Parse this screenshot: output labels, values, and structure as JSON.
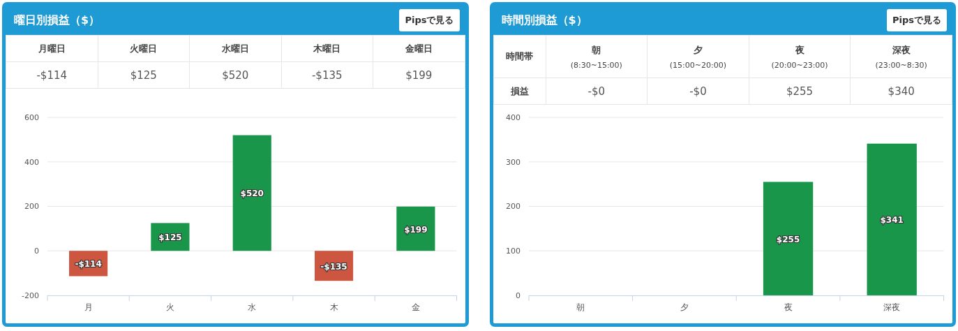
{
  "panels": [
    {
      "title": "曜日別損益（$）",
      "button": "Pipsで見る",
      "table": {
        "headers": [
          {
            "label": "月曜日"
          },
          {
            "label": "火曜日"
          },
          {
            "label": "水曜日"
          },
          {
            "label": "木曜日"
          },
          {
            "label": "金曜日"
          }
        ],
        "values": [
          "-$114",
          "$125",
          "$520",
          "-$135",
          "$199"
        ]
      },
      "chart_data": {
        "type": "bar",
        "categories": [
          "月",
          "火",
          "水",
          "木",
          "金"
        ],
        "values": [
          -114,
          125,
          520,
          -135,
          199
        ],
        "ylim": [
          -200,
          600
        ],
        "yticks": [
          -200,
          0,
          200,
          400,
          600
        ],
        "grid": true,
        "value_labels": [
          "-$114",
          "$125",
          "$520",
          "-$135",
          "$199"
        ]
      }
    },
    {
      "title": "時間別損益（$）",
      "button": "Pipsで見る",
      "table": {
        "row_labels": [
          "時間帯",
          "損益"
        ],
        "headers": [
          {
            "label": "朝",
            "sub": "(8:30~15:00)"
          },
          {
            "label": "夕",
            "sub": "(15:00~20:00)"
          },
          {
            "label": "夜",
            "sub": "(20:00~23:00)"
          },
          {
            "label": "深夜",
            "sub": "(23:00~8:30)"
          }
        ],
        "values": [
          "-$0",
          "-$0",
          "$255",
          "$340"
        ]
      },
      "chart_data": {
        "type": "bar",
        "categories": [
          "朝",
          "夕",
          "夜",
          "深夜"
        ],
        "values": [
          0,
          0,
          255,
          341
        ],
        "ylim": [
          0,
          400
        ],
        "yticks": [
          0,
          100,
          200,
          300,
          400
        ],
        "grid": true,
        "value_labels": [
          null,
          null,
          "$255",
          "$341"
        ]
      }
    }
  ]
}
